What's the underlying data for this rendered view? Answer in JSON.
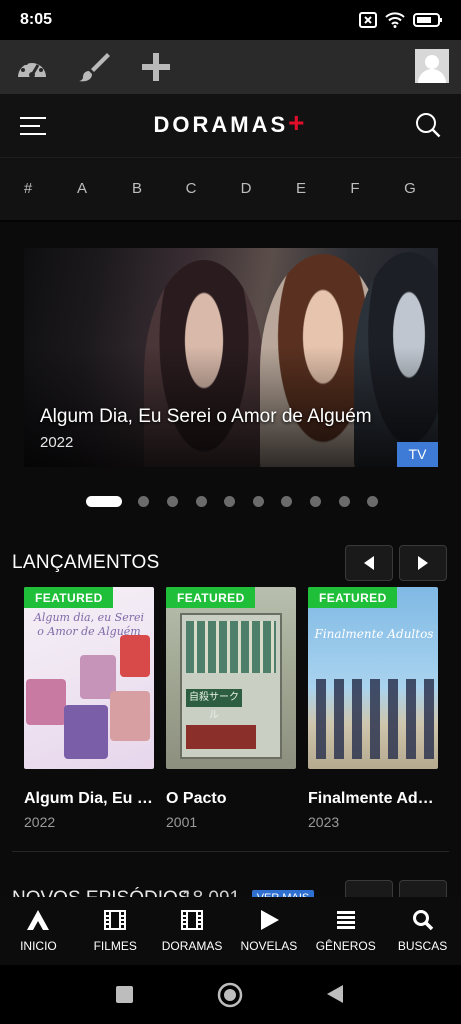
{
  "status_bar": {
    "time": "8:05"
  },
  "header": {
    "logo_text": "DORAMAS",
    "logo_plus": "+",
    "menu_icon": "hamburger-menu-icon",
    "search_icon": "search-icon"
  },
  "toolbar": {
    "icons": [
      "dashboard-icon",
      "brush-icon",
      "plus-icon",
      "avatar"
    ]
  },
  "alphabet": [
    "#",
    "A",
    "B",
    "C",
    "D",
    "E",
    "F",
    "G"
  ],
  "hero": {
    "title": "Algum Dia, Eu Serei o Amor de Alguém",
    "year": "2022",
    "badge": "TV",
    "slides_count": 10,
    "active_slide": 1
  },
  "lancamentos": {
    "title": "LANÇAMENTOS",
    "items": [
      {
        "badge": "FEATURED",
        "title": "Algum Dia, Eu S...",
        "year": "2022",
        "poster_text": "Algum dia, eu Serei o Amor de Alguém"
      },
      {
        "badge": "FEATURED",
        "title": "O Pacto",
        "year": "2001",
        "poster_text": "自殺サークル"
      },
      {
        "badge": "FEATURED",
        "title": "Finalmente Adu...",
        "year": "2023",
        "poster_text": "Finalmente Adultos"
      }
    ]
  },
  "novos": {
    "title": "NOVOS EPISÓDIOS",
    "count": "18.091",
    "badge": "VER MAIS"
  },
  "bottom_nav": [
    {
      "label": "INICIO",
      "icon": "home-a-icon"
    },
    {
      "label": "FILMES",
      "icon": "film-icon"
    },
    {
      "label": "DORAMAS",
      "icon": "film-icon"
    },
    {
      "label": "NOVELAS",
      "icon": "play-icon"
    },
    {
      "label": "GÊNEROS",
      "icon": "list-icon"
    },
    {
      "label": "BUSCAS",
      "icon": "search-icon"
    }
  ],
  "colors": {
    "accent_red": "#e10e2a",
    "featured_green": "#1fbf3a",
    "badge_blue": "#3d7bd6"
  }
}
